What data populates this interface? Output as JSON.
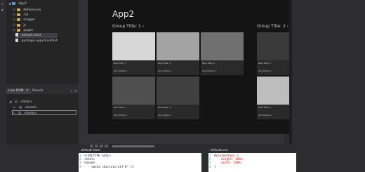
{
  "solution_explorer": {
    "project": "App2",
    "items": [
      {
        "label": "References",
        "kind": "folder"
      },
      {
        "label": "css",
        "kind": "folder"
      },
      {
        "label": "images",
        "kind": "folder"
      },
      {
        "label": "js",
        "kind": "folder"
      },
      {
        "label": "pages",
        "kind": "folder"
      },
      {
        "label": "default.html",
        "kind": "file",
        "selected": true
      },
      {
        "label": "package.appxmanifest",
        "kind": "file"
      }
    ]
  },
  "dom_panel": {
    "tabs": [
      "Live DOM",
      "Device"
    ],
    "close_glyph": "✕",
    "nodes": [
      "<html>",
      "<head>",
      "<body>"
    ]
  },
  "app": {
    "title": "App2",
    "group1_title": "Group Title: 1",
    "group2_title": "Group Title: 2",
    "chevron": "›",
    "tiles_group1": [
      {
        "title": "Item Title: 1",
        "subtitle": "Item Subtitle: 1",
        "color": "#d7d7d7"
      },
      {
        "title": "Item Title: 3",
        "subtitle": "Item Subtitle: 3",
        "color": "#a3a3a3"
      },
      {
        "title": "Item Title: 5",
        "subtitle": "Item Subtitle: 5",
        "color": "#707070"
      },
      {
        "title": "Item Title: 2",
        "subtitle": "Item Subtitle: 2",
        "color": "#4f4f4f"
      },
      {
        "title": "Item Title: 4",
        "subtitle": "Item Subtitle: 4",
        "color": "#404040"
      }
    ],
    "tiles_group2": [
      {
        "title": "Item Title: 1",
        "subtitle": "Item Subtitle: 1",
        "color": "#3a3a3a"
      },
      {
        "title": "Item Title: 2",
        "subtitle": "Item Subtitle: 2",
        "color": "#bdbdbd"
      }
    ]
  },
  "editor1": {
    "tab": "default.html",
    "line_numbers": [
      "1",
      "2",
      "3",
      "4"
    ],
    "lines": [
      "<!DOCTYPE html>",
      "<html>",
      "<head>",
      "    <meta charset=\"utf-8\" />"
    ]
  },
  "editor2": {
    "tab": "default.css",
    "line_numbers": [
      "1",
      "2",
      "3",
      "4"
    ],
    "lines": [
      "#contenthost {",
      "    height: 100%;",
      "    width: 100%;",
      "}"
    ]
  }
}
